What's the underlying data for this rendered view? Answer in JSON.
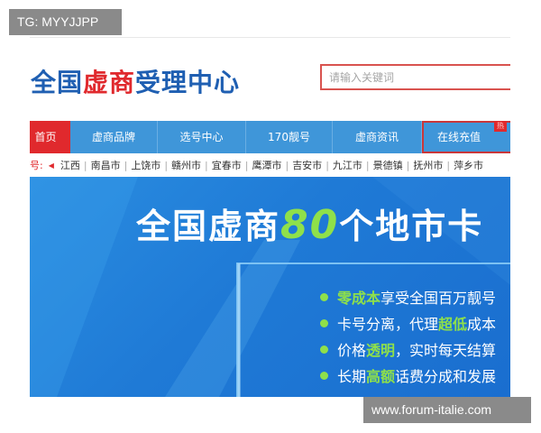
{
  "tag_label": "TG: MYYJJPP",
  "logo": {
    "part1": "全国",
    "part2": "虚商",
    "part3": "受理中心"
  },
  "search": {
    "placeholder": "请输入关键词"
  },
  "nav": {
    "items": [
      {
        "label": "首页"
      },
      {
        "label": "虚商品牌"
      },
      {
        "label": "选号中心"
      },
      {
        "label": "170靓号"
      },
      {
        "label": "虚商资讯"
      },
      {
        "label": "在线充值"
      }
    ],
    "hot_badge": "热"
  },
  "cities": {
    "prefix": "号:",
    "items": [
      "江西",
      "南昌市",
      "上饶市",
      "赣州市",
      "宜春市",
      "鹰潭市",
      "吉安市",
      "九江市",
      "景德镇",
      "抚州市",
      "萍乡市"
    ]
  },
  "banner": {
    "headline_a": "全国虚商",
    "headline_num": "80",
    "headline_b": "个地市卡",
    "features": [
      {
        "highlight": "零成本",
        "text": "享受全国百万靓号"
      },
      {
        "lead": "卡号分离，代理",
        "highlight": "超低",
        "text": "成本"
      },
      {
        "lead": "价格",
        "highlight": "透明",
        "text": "，实时每天结算"
      },
      {
        "lead": "长期",
        "highlight": "高额",
        "text": "话费分成和发展"
      }
    ]
  },
  "watermark": "www.forum-italie.com",
  "colors": {
    "nav_blue": "#3f96d9",
    "brand_red": "#e0292d",
    "brand_blue": "#1f5fb2",
    "accent_green": "#8fe04a"
  }
}
